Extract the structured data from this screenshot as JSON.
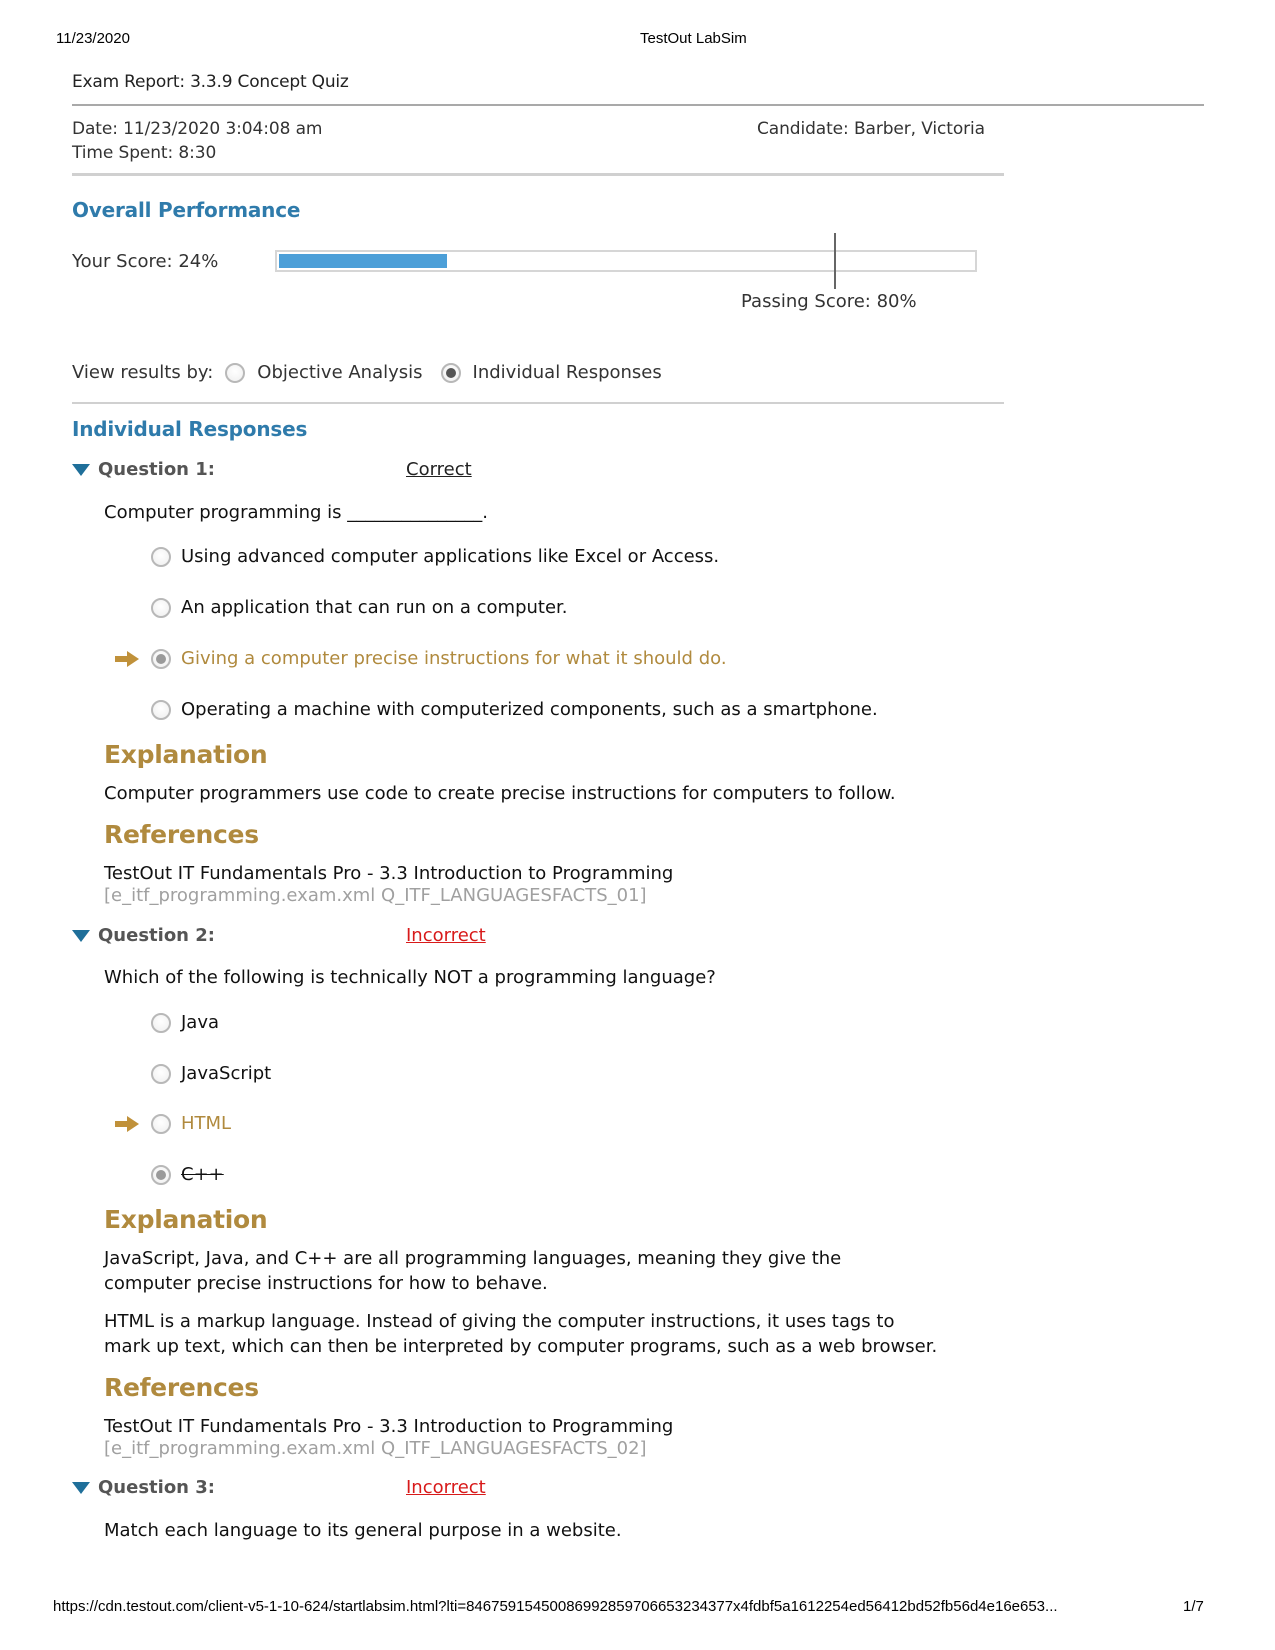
{
  "print_header": {
    "date": "11/23/2020",
    "title": "TestOut LabSim"
  },
  "report": {
    "title": "Exam Report: 3.3.9 Concept Quiz",
    "date": "Date: 11/23/2020 3:04:08 am",
    "time_spent": "Time Spent: 8:30",
    "candidate": "Candidate: Barber, Victoria"
  },
  "performance": {
    "heading": "Overall Performance",
    "score_label": "Your Score: 24%",
    "score_percent": 24,
    "passing_label": "Passing Score: 80%",
    "passing_percent": 80,
    "bar_color": "#4c9fd8"
  },
  "view_results": {
    "label": "View results by:",
    "options": [
      {
        "label": "Objective Analysis",
        "selected": false
      },
      {
        "label": "Individual Responses",
        "selected": true
      }
    ]
  },
  "responses": {
    "heading": "Individual Responses",
    "explanation_heading": "Explanation",
    "references_heading": "References",
    "questions": [
      {
        "label": "Question 1:",
        "status": "Correct",
        "text": "Computer programming is _______________.",
        "options": [
          {
            "text": "Using advanced computer applications like Excel or Access.",
            "selected": false,
            "correct": false
          },
          {
            "text": "An application that can run on a computer.",
            "selected": false,
            "correct": false
          },
          {
            "text": "Giving a computer precise instructions for what it should do.",
            "selected": true,
            "correct": true
          },
          {
            "text": "Operating a machine with computerized components, such as a smartphone.",
            "selected": false,
            "correct": false
          }
        ],
        "explanation": [
          "Computer programmers use code to create precise instructions for computers to follow."
        ],
        "reference": "TestOut IT Fundamentals Pro - 3.3 Introduction to Programming",
        "reference_id": "[e_itf_programming.exam.xml Q_ITF_LANGUAGESFACTS_01]"
      },
      {
        "label": "Question 2:",
        "status": "Incorrect",
        "text": "Which of the following is technically NOT a programming language?",
        "options": [
          {
            "text": "Java",
            "selected": false,
            "correct": false
          },
          {
            "text": "JavaScript",
            "selected": false,
            "correct": false
          },
          {
            "text": "HTML",
            "selected": false,
            "correct": true
          },
          {
            "text": "C++",
            "selected": true,
            "correct": false
          }
        ],
        "explanation": [
          "JavaScript, Java, and C++ are all programming languages, meaning they give the computer precise instructions for how to behave.",
          "HTML is a markup language. Instead of giving the computer instructions, it uses tags to mark up text, which can then be interpreted by computer programs, such as a web browser."
        ],
        "reference": "TestOut IT Fundamentals Pro - 3.3 Introduction to Programming",
        "reference_id": "[e_itf_programming.exam.xml Q_ITF_LANGUAGESFACTS_02]"
      },
      {
        "label": "Question 3:",
        "status": "Incorrect",
        "text": "Match each language to its general purpose in a website."
      }
    ]
  },
  "print_footer": {
    "url": "https://cdn.testout.com/client-v5-1-10-624/startlabsim.html?lti=846759154500869928597066532343​77x4fdbf5a1612254ed56412bd52fb56d4e16e653...",
    "page": "1/7"
  },
  "colors": {
    "section_heading": "#2f7bab",
    "sub_heading": "#b08a3e",
    "incorrect": "#d81a1a",
    "correct_answer": "#b08a3e"
  }
}
